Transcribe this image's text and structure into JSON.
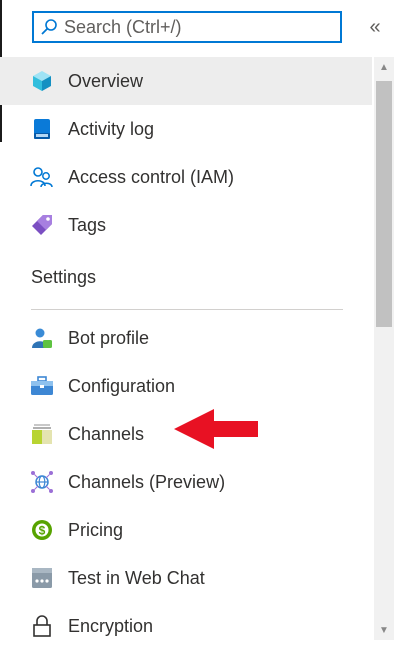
{
  "search": {
    "placeholder": "Search (Ctrl+/)",
    "value": ""
  },
  "collapse_label": "«",
  "nav": {
    "items": [
      {
        "label": "Overview",
        "icon": "cube-icon"
      },
      {
        "label": "Activity log",
        "icon": "activity-log-icon"
      },
      {
        "label": "Access control (IAM)",
        "icon": "people-icon"
      },
      {
        "label": "Tags",
        "icon": "tag-icon"
      }
    ],
    "settings_heading": "Settings",
    "settings_items": [
      {
        "label": "Bot profile",
        "icon": "bot-profile-icon"
      },
      {
        "label": "Configuration",
        "icon": "toolbox-icon"
      },
      {
        "label": "Channels",
        "icon": "channels-icon"
      },
      {
        "label": "Channels (Preview)",
        "icon": "globe-network-icon"
      },
      {
        "label": "Pricing",
        "icon": "dollar-circle-icon"
      },
      {
        "label": "Test in Web Chat",
        "icon": "web-chat-icon"
      },
      {
        "label": "Encryption",
        "icon": "lock-icon"
      }
    ]
  },
  "colors": {
    "accent": "#0078d4",
    "active_bg": "#ededed",
    "arrow": "#e81123"
  }
}
